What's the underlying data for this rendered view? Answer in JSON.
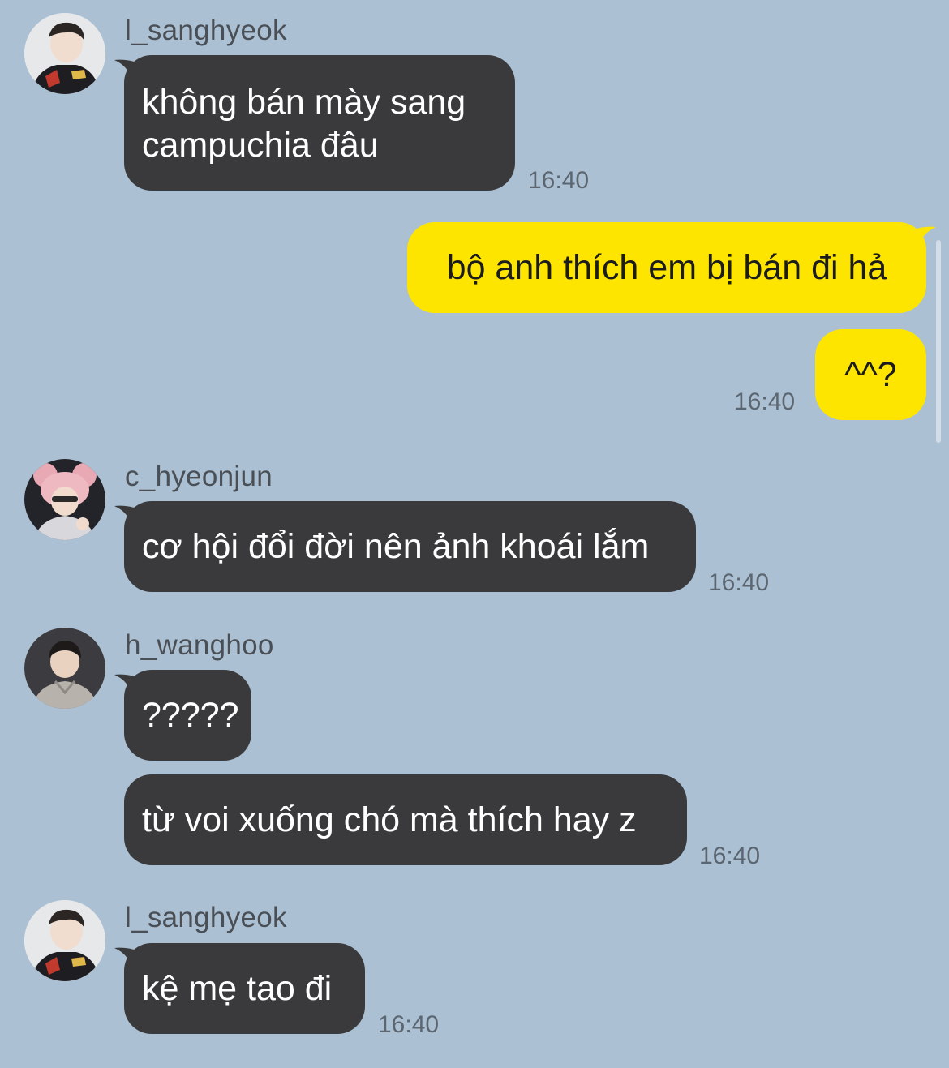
{
  "colors": {
    "background": "#abc0d3",
    "incoming_bubble": "#3a3a3c",
    "outgoing_bubble": "#fee500"
  },
  "messages": {
    "m1": {
      "sender": "l_sanghyeok",
      "line1": "không bán mày sang",
      "line2": "campuchia đâu",
      "time": "16:40"
    },
    "m2": {
      "text": "bộ anh thích em bị bán đi hả"
    },
    "m3": {
      "text": "^^?",
      "time": "16:40"
    },
    "m4": {
      "sender": "c_hyeonjun",
      "text": "cơ hội đổi đời nên ảnh khoái lắm",
      "time": "16:40"
    },
    "m5": {
      "sender": "h_wanghoo",
      "text": "?????"
    },
    "m6": {
      "text": "từ voi xuống chó mà thích hay z",
      "time": "16:40"
    },
    "m7": {
      "sender": "l_sanghyeok",
      "text": "kệ mẹ tao đi",
      "time": "16:40"
    }
  },
  "avatars": {
    "a1": "avatar-l_sanghyeok",
    "a2": "avatar-c_hyeonjun",
    "a3": "avatar-h_wanghoo",
    "a4": "avatar-l_sanghyeok"
  }
}
